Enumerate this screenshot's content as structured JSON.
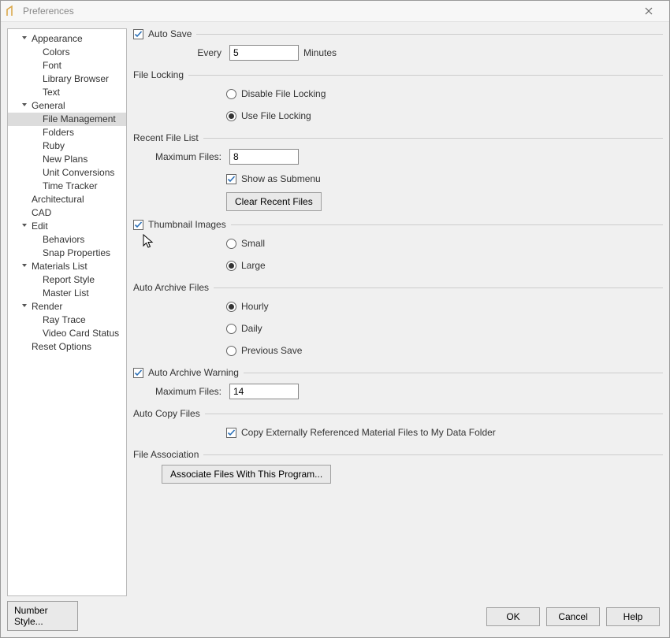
{
  "window": {
    "title": "Preferences"
  },
  "sidebar": {
    "number_style_btn": "Number Style...",
    "items": [
      {
        "label": "Appearance",
        "lvl": 1,
        "exp": true
      },
      {
        "label": "Colors",
        "lvl": 2
      },
      {
        "label": "Font",
        "lvl": 2
      },
      {
        "label": "Library Browser",
        "lvl": 2
      },
      {
        "label": "Text",
        "lvl": 2
      },
      {
        "label": "General",
        "lvl": 1,
        "exp": true
      },
      {
        "label": "File Management",
        "lvl": 2,
        "selected": true
      },
      {
        "label": "Folders",
        "lvl": 2
      },
      {
        "label": "Ruby",
        "lvl": 2
      },
      {
        "label": "New Plans",
        "lvl": 2
      },
      {
        "label": "Unit Conversions",
        "lvl": 2
      },
      {
        "label": "Time Tracker",
        "lvl": 2
      },
      {
        "label": "Architectural",
        "lvl": 1
      },
      {
        "label": "CAD",
        "lvl": 1
      },
      {
        "label": "Edit",
        "lvl": 1,
        "exp": true
      },
      {
        "label": "Behaviors",
        "lvl": 2
      },
      {
        "label": "Snap Properties",
        "lvl": 2
      },
      {
        "label": "Materials List",
        "lvl": 1,
        "exp": true
      },
      {
        "label": "Report Style",
        "lvl": 2
      },
      {
        "label": "Master List",
        "lvl": 2
      },
      {
        "label": "Render",
        "lvl": 1,
        "exp": true
      },
      {
        "label": "Ray Trace",
        "lvl": 2
      },
      {
        "label": "Video Card Status",
        "lvl": 2
      },
      {
        "label": "Reset Options",
        "lvl": 1
      }
    ]
  },
  "panel": {
    "auto_save": {
      "title": "Auto Save",
      "checked": true,
      "every_label": "Every",
      "every_value": "5",
      "minutes_label": "Minutes"
    },
    "file_locking": {
      "title": "File Locking",
      "options": [
        {
          "label": "Disable File Locking",
          "selected": false
        },
        {
          "label": "Use File Locking",
          "selected": true
        }
      ]
    },
    "recent_files": {
      "title": "Recent File List",
      "max_label": "Maximum Files:",
      "max_value": "8",
      "submenu": {
        "label": "Show as Submenu",
        "checked": true
      },
      "clear_btn": "Clear Recent Files"
    },
    "thumbnails": {
      "title": "Thumbnail Images",
      "checked": true,
      "options": [
        {
          "label": "Small",
          "selected": false
        },
        {
          "label": "Large",
          "selected": true
        }
      ]
    },
    "auto_archive": {
      "title": "Auto Archive Files",
      "options": [
        {
          "label": "Hourly",
          "selected": true
        },
        {
          "label": "Daily",
          "selected": false
        },
        {
          "label": "Previous Save",
          "selected": false
        }
      ]
    },
    "auto_archive_warning": {
      "title": "Auto Archive Warning",
      "checked": true,
      "max_label": "Maximum Files:",
      "max_value": "14"
    },
    "auto_copy": {
      "title": "Auto Copy Files",
      "opt": {
        "label": "Copy Externally Referenced Material Files to My Data Folder",
        "checked": true
      }
    },
    "file_assoc": {
      "title": "File Association",
      "btn": "Associate Files With This Program..."
    }
  },
  "footer": {
    "ok": "OK",
    "cancel": "Cancel",
    "help": "Help"
  }
}
